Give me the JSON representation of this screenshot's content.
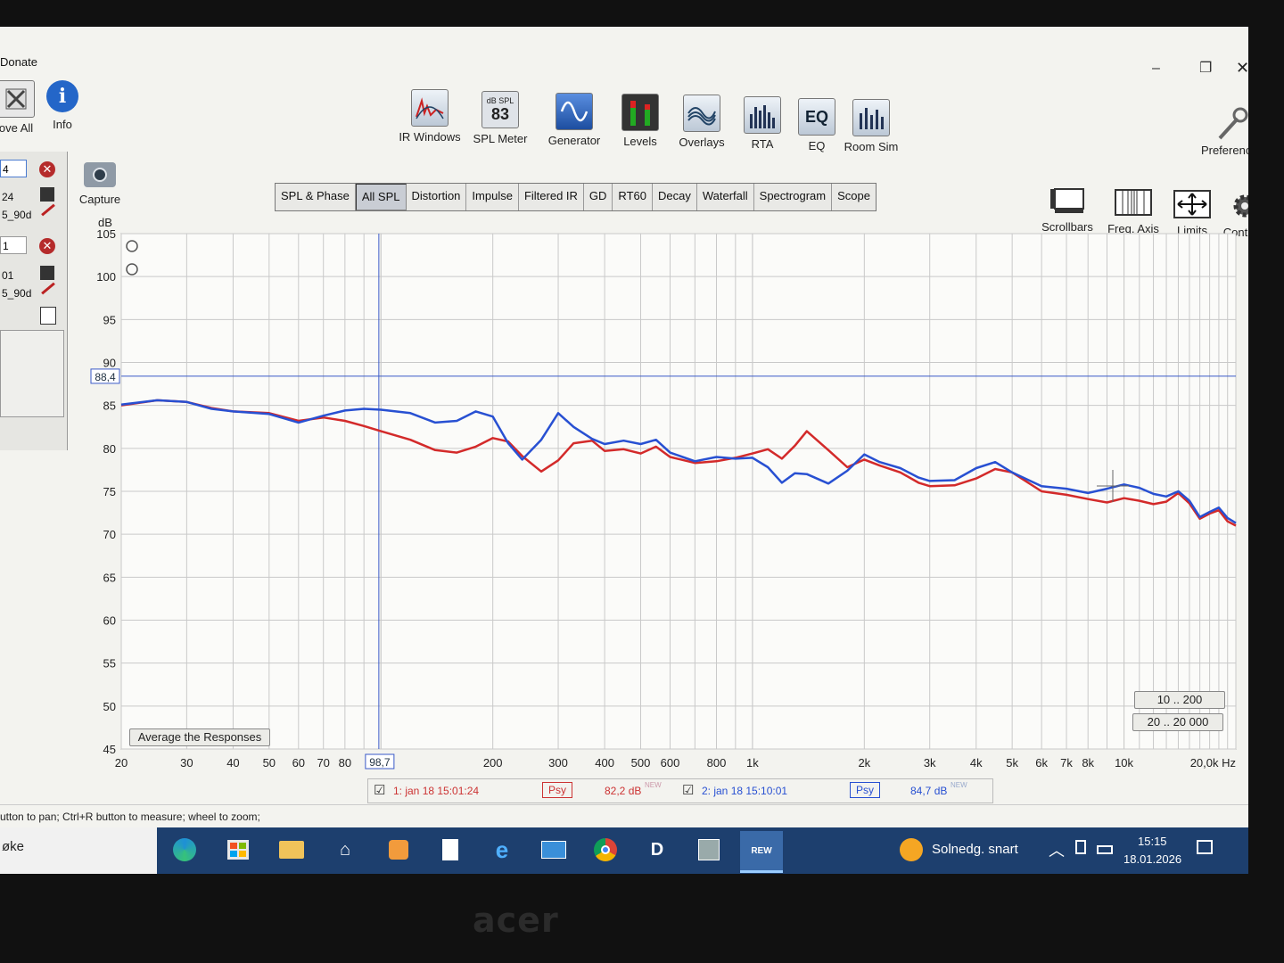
{
  "window": {
    "title": "Donate",
    "controls": [
      "–",
      "❐",
      "✕"
    ]
  },
  "left_toolbar": {
    "remove_all": "ove All",
    "info": "Info",
    "capture": "Capture"
  },
  "measurements": [
    {
      "field": "4",
      "line1": "24",
      "line2": "5_90d"
    },
    {
      "field": "1",
      "line1": "01",
      "line2": "5_90d"
    }
  ],
  "toolbar": [
    {
      "id": "ir-windows",
      "label": "IR Windows",
      "icon": "ir-windows-icon"
    },
    {
      "id": "spl-meter",
      "label": "SPL Meter",
      "icon": "spl-meter-icon",
      "icon_top": "dB SPL",
      "icon_value": "83"
    },
    {
      "id": "generator",
      "label": "Generator",
      "icon": "generator-icon"
    },
    {
      "id": "levels",
      "label": "Levels",
      "icon": "levels-icon"
    },
    {
      "id": "overlays",
      "label": "Overlays",
      "icon": "overlays-icon"
    },
    {
      "id": "rta",
      "label": "RTA",
      "icon": "rta-icon"
    },
    {
      "id": "eq",
      "label": "EQ",
      "icon": "eq-icon",
      "icon_text": "EQ"
    },
    {
      "id": "room-sim",
      "label": "Room Sim",
      "icon": "room-sim-icon"
    }
  ],
  "preferences": "Preferences",
  "graph_tools": [
    {
      "id": "scrollbars",
      "label": "Scrollbars"
    },
    {
      "id": "freq-axis",
      "label": "Freq. Axis"
    },
    {
      "id": "limits",
      "label": "Limits"
    },
    {
      "id": "controls",
      "label": "Controls"
    }
  ],
  "tabs": [
    "SPL & Phase",
    "All SPL",
    "Distortion",
    "Impulse",
    "Filtered IR",
    "GD",
    "RT60",
    "Decay",
    "Waterfall",
    "Spectrogram",
    "Scope"
  ],
  "active_tab": "All SPL",
  "chart_data": {
    "type": "line",
    "ylabel": "dB",
    "xlabel": "Hz",
    "x_scale": "log",
    "xlim": [
      20,
      20000
    ],
    "ylim": [
      45,
      105
    ],
    "y_ticks": [
      "45",
      "50",
      "55",
      "60",
      "65",
      "70",
      "75",
      "80",
      "85",
      "90",
      "95",
      "100",
      "105"
    ],
    "x_ticks": [
      {
        "v": 20,
        "t": "20"
      },
      {
        "v": 30,
        "t": "30"
      },
      {
        "v": 40,
        "t": "40"
      },
      {
        "v": 50,
        "t": "50"
      },
      {
        "v": 60,
        "t": "60"
      },
      {
        "v": 70,
        "t": "70"
      },
      {
        "v": 80,
        "t": "80"
      },
      {
        "v": 200,
        "t": "200"
      },
      {
        "v": 300,
        "t": "300"
      },
      {
        "v": 400,
        "t": "400"
      },
      {
        "v": 500,
        "t": "500"
      },
      {
        "v": 600,
        "t": "600"
      },
      {
        "v": 800,
        "t": "800"
      },
      {
        "v": 1000,
        "t": "1k"
      },
      {
        "v": 2000,
        "t": "2k"
      },
      {
        "v": 3000,
        "t": "3k"
      },
      {
        "v": 4000,
        "t": "4k"
      },
      {
        "v": 5000,
        "t": "5k"
      },
      {
        "v": 6000,
        "t": "6k"
      },
      {
        "v": 7000,
        "t": "7k"
      },
      {
        "v": 8000,
        "t": "8k"
      },
      {
        "v": 10000,
        "t": "10k"
      },
      {
        "v": 20000,
        "t": "20,0k Hz"
      }
    ],
    "cursor": {
      "x": 98.7,
      "x_label": "98,7",
      "y": 88.4,
      "y_label": "88,4"
    },
    "series": [
      {
        "name": "1: jan 18 15:01:24",
        "color": "#d32a2a",
        "x": [
          20,
          25,
          30,
          35,
          40,
          50,
          60,
          70,
          80,
          90,
          100,
          120,
          140,
          160,
          180,
          200,
          220,
          240,
          270,
          300,
          330,
          370,
          400,
          450,
          500,
          550,
          600,
          700,
          800,
          900,
          1000,
          1100,
          1200,
          1300,
          1400,
          1600,
          1800,
          2000,
          2200,
          2500,
          2800,
          3000,
          3500,
          4000,
          4500,
          5000,
          6000,
          7000,
          8000,
          9000,
          10000,
          11000,
          12000,
          13000,
          14000,
          15000,
          16000,
          17000,
          18000,
          19000,
          20000
        ],
        "y": [
          85.0,
          85.6,
          85.4,
          84.7,
          84.3,
          84.1,
          83.2,
          83.6,
          83.2,
          82.6,
          82.0,
          81.0,
          79.8,
          79.5,
          80.2,
          81.2,
          80.8,
          79.1,
          77.3,
          78.6,
          80.6,
          80.9,
          79.7,
          79.9,
          79.4,
          80.2,
          79.0,
          78.3,
          78.5,
          78.9,
          79.4,
          79.9,
          78.8,
          80.3,
          82.0,
          79.8,
          77.8,
          78.7,
          78.0,
          77.2,
          76.0,
          75.6,
          75.7,
          76.5,
          77.6,
          77.2,
          75.0,
          74.6,
          74.1,
          73.7,
          74.2,
          73.9,
          73.5,
          73.8,
          74.8,
          73.6,
          71.8,
          72.4,
          72.8,
          71.5,
          71.0
        ]
      },
      {
        "name": "2: jan 18 15:10:01",
        "color": "#2850d2",
        "x": [
          20,
          25,
          30,
          35,
          40,
          50,
          60,
          70,
          80,
          90,
          100,
          120,
          140,
          160,
          180,
          200,
          220,
          240,
          270,
          300,
          330,
          370,
          400,
          450,
          500,
          550,
          600,
          700,
          800,
          900,
          1000,
          1100,
          1200,
          1300,
          1400,
          1600,
          1800,
          2000,
          2200,
          2500,
          2800,
          3000,
          3500,
          4000,
          4500,
          5000,
          6000,
          7000,
          8000,
          9000,
          10000,
          11000,
          12000,
          13000,
          14000,
          15000,
          16000,
          17000,
          18000,
          19000,
          20000
        ],
        "y": [
          85.1,
          85.6,
          85.4,
          84.6,
          84.3,
          84.0,
          83.0,
          83.8,
          84.4,
          84.6,
          84.5,
          84.1,
          83.0,
          83.2,
          84.3,
          83.7,
          80.6,
          78.7,
          81.0,
          84.1,
          82.5,
          81.1,
          80.5,
          80.9,
          80.5,
          81.0,
          79.5,
          78.5,
          79.0,
          78.8,
          78.9,
          77.8,
          76.0,
          77.1,
          77.0,
          75.9,
          77.4,
          79.3,
          78.4,
          77.7,
          76.6,
          76.2,
          76.3,
          77.7,
          78.4,
          77.2,
          75.6,
          75.3,
          74.8,
          75.3,
          75.8,
          75.4,
          74.7,
          74.4,
          75.0,
          73.9,
          72.0,
          72.6,
          73.1,
          71.9,
          71.3
        ]
      }
    ]
  },
  "plot_buttons": {
    "average": "Average the Responses",
    "range1": "10 .. 200",
    "range2": "20 .. 20 000"
  },
  "legend": [
    {
      "check": "☑",
      "name": "1: jan 18 15:01:24",
      "smoothing": "Psy",
      "level": "82,2 dB",
      "tag": "NEW",
      "color": "#d32a2a"
    },
    {
      "check": "☑",
      "name": "2: jan 18 15:10:01",
      "smoothing": "Psy",
      "level": "84,7 dB",
      "tag": "NEW",
      "color": "#2850d2"
    }
  ],
  "status": "utton to pan; Ctrl+R button to measure; wheel to zoom;",
  "taskbar": {
    "search_text": "øke",
    "weather": "Solnedg. snart",
    "time": "15:15",
    "date": "18.01.2026",
    "rew_label": "REW"
  },
  "bezel": {
    "brand": "acer"
  }
}
